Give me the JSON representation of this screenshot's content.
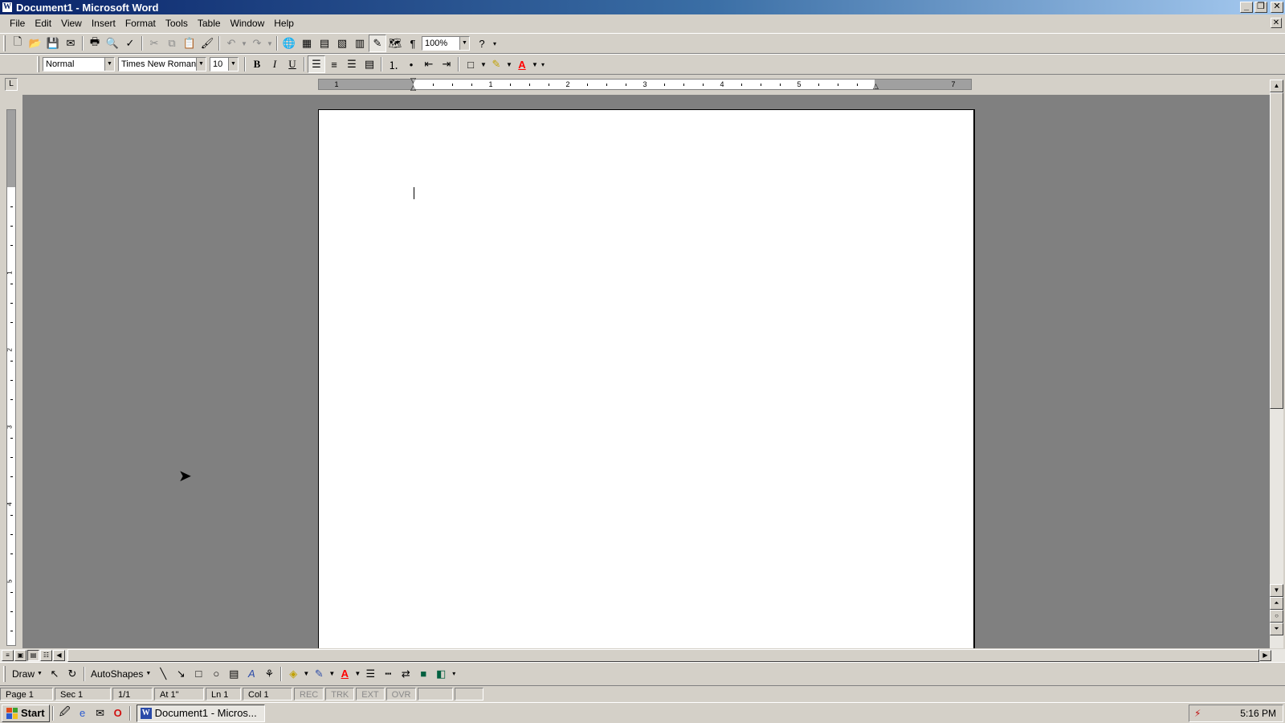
{
  "window": {
    "title": "Document1 - Microsoft Word",
    "app_icon_letter": "W",
    "minimize": "_",
    "restore": "❐",
    "close": "✕",
    "doc_close": "✕"
  },
  "menu": [
    "File",
    "Edit",
    "View",
    "Insert",
    "Format",
    "Tools",
    "Table",
    "Window",
    "Help"
  ],
  "standard_toolbar": {
    "zoom_value": "100%",
    "buttons": [
      {
        "name": "new-document-icon",
        "glyph": "🗋"
      },
      {
        "name": "open-icon",
        "glyph": "📂"
      },
      {
        "name": "save-icon",
        "glyph": "💾"
      },
      {
        "name": "email-icon",
        "glyph": "✉"
      },
      {
        "name": "print-icon",
        "glyph": "🖶"
      },
      {
        "name": "print-preview-icon",
        "glyph": "🔍"
      },
      {
        "name": "spelling-icon",
        "glyph": "✓"
      },
      {
        "name": "cut-icon",
        "glyph": "✂"
      },
      {
        "name": "copy-icon",
        "glyph": "⧉"
      },
      {
        "name": "paste-icon",
        "glyph": "📋"
      },
      {
        "name": "format-painter-icon",
        "glyph": "🖌"
      },
      {
        "name": "undo-icon",
        "glyph": "↶"
      },
      {
        "name": "redo-icon",
        "glyph": "↷"
      },
      {
        "name": "hyperlink-icon",
        "glyph": "🌐"
      },
      {
        "name": "tables-borders-icon",
        "glyph": "▦"
      },
      {
        "name": "insert-table-icon",
        "glyph": "▤"
      },
      {
        "name": "insert-excel-icon",
        "glyph": "▧"
      },
      {
        "name": "columns-icon",
        "glyph": "▥"
      },
      {
        "name": "drawing-icon",
        "glyph": "✎"
      },
      {
        "name": "document-map-icon",
        "glyph": "🗺"
      },
      {
        "name": "show-hide-icon",
        "glyph": "¶"
      },
      {
        "name": "help-icon",
        "glyph": "?"
      }
    ]
  },
  "formatting_toolbar": {
    "style": "Normal",
    "font": "Times New Roman",
    "size": "10",
    "bold": "B",
    "italic": "I",
    "underline": "U",
    "font_color_letter": "A"
  },
  "ruler": {
    "h_numbers": [
      "1",
      "1",
      "2",
      "3",
      "4",
      "5",
      "7"
    ],
    "v_numbers": [
      "1",
      "2",
      "3",
      "4",
      "5"
    ],
    "tab_selector": "L"
  },
  "drawing_toolbar": {
    "draw": "Draw",
    "autoshapes": "AutoShapes",
    "font_color_letter": "A"
  },
  "status": {
    "page": "Page 1",
    "sec": "Sec 1",
    "pages": "1/1",
    "at": "At 1\"",
    "ln": "Ln 1",
    "col": "Col 1",
    "rec": "REC",
    "trk": "TRK",
    "ext": "EXT",
    "ovr": "OVR"
  },
  "taskbar": {
    "start": "Start",
    "task": "Document1 - Micros...",
    "clock": "5:16 PM"
  },
  "colors": {
    "titlebar_start": "#0a246a",
    "titlebar_end": "#a6caf0",
    "workspace": "#808080",
    "highlight": "#ffff00",
    "font_color": "#ff0000"
  }
}
